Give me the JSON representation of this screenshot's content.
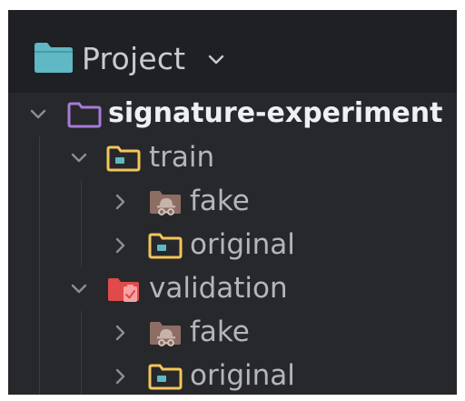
{
  "header": {
    "title": "Project",
    "icon": "project-folder-icon",
    "chevron": "chevron-down-icon"
  },
  "tree": {
    "root": {
      "label": "signature-experiment",
      "icon": "module-folder-icon",
      "expanded": true
    },
    "train": {
      "label": "train",
      "icon": "resource-folder-icon",
      "expanded": true,
      "children": {
        "fake": {
          "label": "fake",
          "icon": "excluded-folder-icon",
          "expanded": false
        },
        "original": {
          "label": "original",
          "icon": "resource-folder-icon",
          "expanded": false
        }
      }
    },
    "validation": {
      "label": "validation",
      "icon": "test-folder-icon",
      "expanded": true,
      "children": {
        "fake": {
          "label": "fake",
          "icon": "excluded-folder-icon",
          "expanded": false
        },
        "original": {
          "label": "original",
          "icon": "resource-folder-icon",
          "expanded": false
        }
      }
    }
  },
  "colors": {
    "header_bg": "#1f2023",
    "tree_bg": "#27282b",
    "text": "#b4b6bb",
    "root_text": "#eef0f3",
    "project_folder": "#5fb8c4",
    "module_folder": "#a77ad8",
    "resource_folder": "#f3c55a",
    "test_folder": "#e04a4a",
    "excluded_folder": "#8d6e63"
  }
}
